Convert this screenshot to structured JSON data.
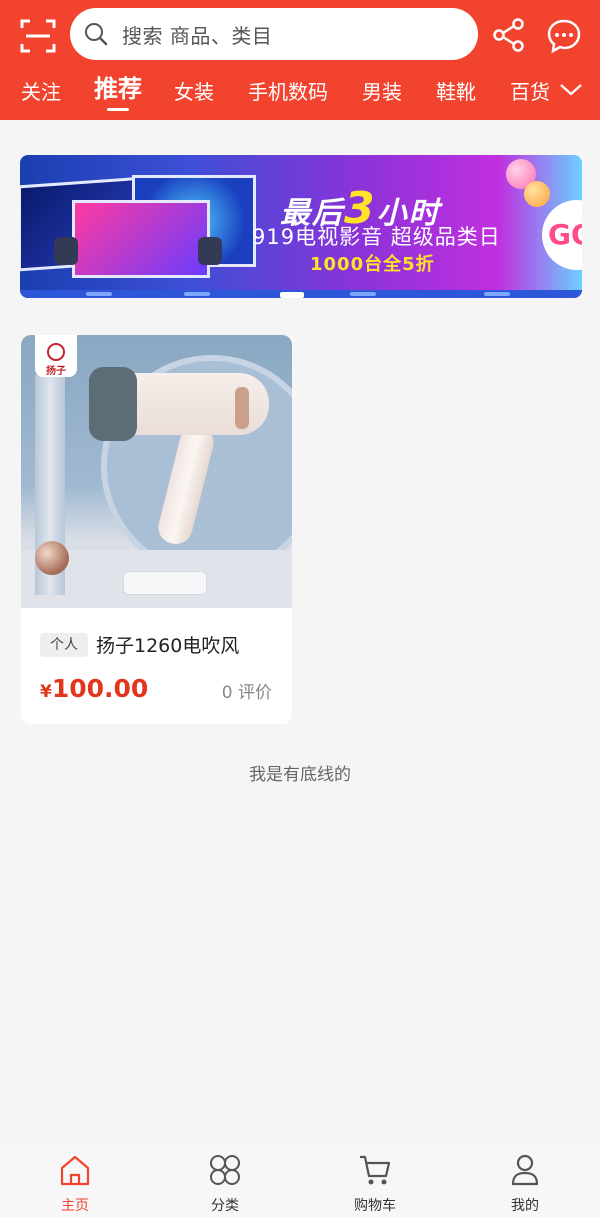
{
  "header": {
    "search_placeholder": "搜索 商品、类目",
    "tabs": [
      "关注",
      "推荐",
      "女装",
      "手机数码",
      "男装",
      "鞋靴",
      "百货"
    ],
    "active_tab": "推荐"
  },
  "banner": {
    "headline_prefix": "最后",
    "headline_num": "3",
    "headline_suffix": "小时",
    "subtitle": "919电视影音 超级品类日",
    "promo": "1000台全5折",
    "go_label": "GO",
    "dots_count": 5,
    "active_dot": 2
  },
  "product": {
    "brand_text": "扬子",
    "tag": "个人",
    "title": "扬子1260电吹风",
    "currency": "¥",
    "price": "100.00",
    "reviews": "0 评价"
  },
  "footer_note": "我是有底线的",
  "bottom_nav": {
    "items": [
      {
        "label": "主页",
        "icon": "home-icon"
      },
      {
        "label": "分类",
        "icon": "category-icon"
      },
      {
        "label": "购物车",
        "icon": "cart-icon"
      },
      {
        "label": "我的",
        "icon": "user-icon"
      }
    ],
    "active": "主页"
  },
  "colors": {
    "accent": "#f2432f",
    "price": "#e3361e"
  }
}
